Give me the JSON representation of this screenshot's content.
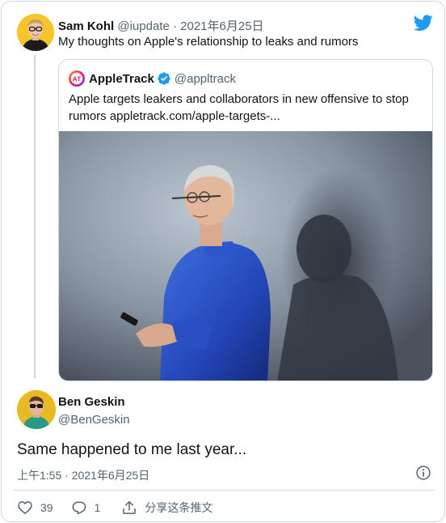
{
  "tweet": {
    "author_name": "Sam Kohl",
    "author_handle": "@iupdate",
    "separator": "·",
    "date": "2021年6月25日",
    "text": "My thoughts on Apple's relationship to leaks and rumors"
  },
  "quoted": {
    "author_name": "AppleTrack",
    "author_handle": "@appltrack",
    "logo_text": "AT",
    "text": "Apple targets leakers and collaborators in new offensive to stop rumors appletrack.com/apple-targets-..."
  },
  "reply": {
    "author_name": "Ben Geskin",
    "author_handle": "@BenGeskin",
    "text": "Same happened to me last year...",
    "timestamp": "上午1:55 · 2021年6月25日"
  },
  "actions": {
    "like_count": "39",
    "reply_count": "1",
    "share_label": "分享这条推文"
  },
  "icons": {
    "brand": "twitter-bird-icon",
    "verified": "verified-badge-icon",
    "info": "info-icon",
    "like": "heart-icon",
    "reply": "reply-icon",
    "share": "share-icon"
  },
  "colors": {
    "twitter_blue": "#1d9bf0",
    "secondary_text": "#536471",
    "border": "#cfd9de"
  }
}
